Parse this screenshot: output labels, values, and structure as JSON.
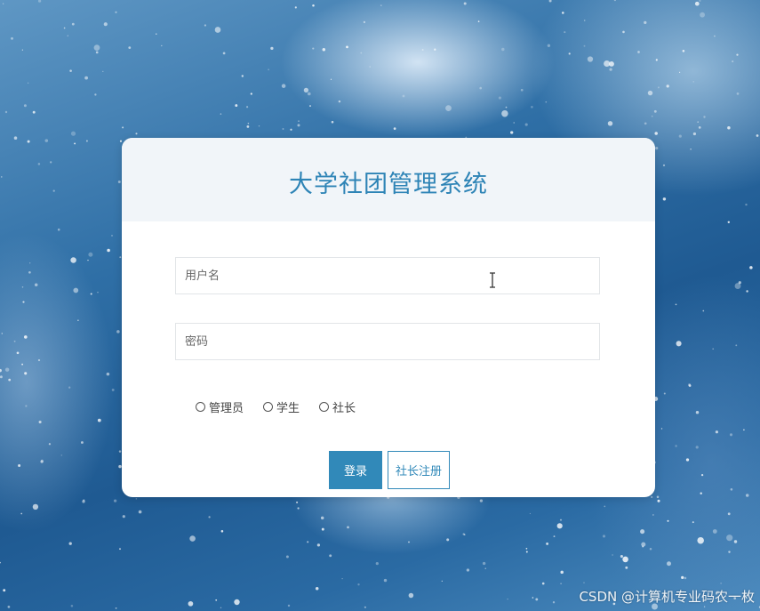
{
  "login": {
    "title": "大学社团管理系统",
    "username_placeholder": "用户名",
    "password_placeholder": "密码",
    "roles": [
      "管理员",
      "学生",
      "社长"
    ],
    "login_button": "登录",
    "register_button": "社长注册"
  },
  "watermark": "CSDN @计算机专业码农一枚",
  "colors": {
    "accent": "#3189b9",
    "title": "#2e84b6",
    "header_bg": "#f1f5f9"
  },
  "icons": {
    "cursor": "text-cursor-icon"
  }
}
